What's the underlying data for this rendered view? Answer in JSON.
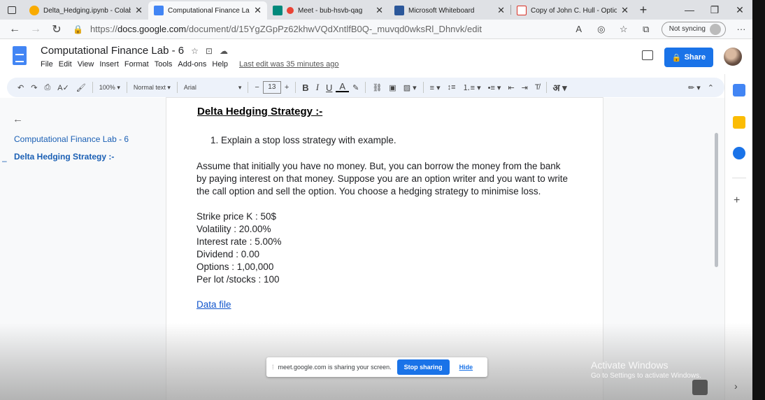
{
  "browser": {
    "tabs": [
      {
        "label": "Delta_Hedging.ipynb - Colab",
        "color": "#f9ab00"
      },
      {
        "label": "Computational Finance Lab",
        "color": "#4285f4"
      },
      {
        "label": "Meet - bub-hsvb-qag",
        "color": "#ea4335"
      },
      {
        "label": "Microsoft Whiteboard",
        "color": "#2b579a"
      },
      {
        "label": "Copy of John C. Hull - Option",
        "color": "#d93025"
      }
    ],
    "url_prefix": "https://",
    "url_domain": "docs.google.com",
    "url_path": "/document/d/15YgZGpPz62khwVQdXntlfB0Q-_muvqd0wksRl_Dhnvk/edit",
    "sync_label": "Not syncing"
  },
  "docs": {
    "title": "Computational Finance Lab - 6",
    "menu": [
      "File",
      "Edit",
      "View",
      "Insert",
      "Format",
      "Tools",
      "Add-ons",
      "Help"
    ],
    "last_edit": "Last edit was 35 minutes ago",
    "share_label": "Share"
  },
  "toolbar": {
    "zoom": "100%",
    "style": "Normal text",
    "font": "Arial",
    "font_size": "13"
  },
  "outline": {
    "items": [
      "Computational Finance Lab - 6",
      "Delta Hedging Strategy :-"
    ]
  },
  "document": {
    "heading": "Delta Hedging Strategy :-",
    "list_item": "1.  Explain a stop loss strategy with example.",
    "paragraph_lines": [
      "Assume that initially you have no money. But, you can borrow the money from the bank",
      "by paying interest on that money. Suppose you are an option writer and you want to write",
      "the call option and sell the option. You choose a hedging strategy to minimise loss."
    ],
    "params": [
      "Strike price K : 50$",
      "Volatility : 20.00%",
      "Interest rate : 5.00%",
      "Dividend : 0.00",
      "Options : 1,00,000",
      "Per lot /stocks : 100"
    ],
    "link": "Data file"
  },
  "sharing": {
    "message": "meet.google.com is sharing your screen.",
    "stop_label": "Stop sharing",
    "hide_label": "Hide"
  },
  "watermark": {
    "line1": "Activate Windows",
    "line2": "Go to Settings to activate Windows."
  }
}
